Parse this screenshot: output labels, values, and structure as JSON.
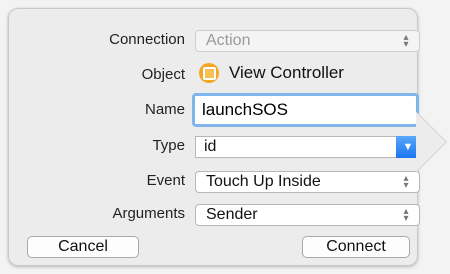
{
  "form": {
    "connection": {
      "label": "Connection",
      "value": "Action"
    },
    "object": {
      "label": "Object",
      "value": "View Controller",
      "icon": "view-controller-icon"
    },
    "name": {
      "label": "Name",
      "value": "launchSOS"
    },
    "type": {
      "label": "Type",
      "value": "id"
    },
    "event": {
      "label": "Event",
      "value": "Touch Up Inside"
    },
    "arguments": {
      "label": "Arguments",
      "value": "Sender"
    }
  },
  "buttons": {
    "cancel": "Cancel",
    "connect": "Connect"
  },
  "colors": {
    "focus_ring": "#7fb5ea",
    "dropdown_accent": "#1b75ef",
    "object_icon": "#f5a623"
  }
}
